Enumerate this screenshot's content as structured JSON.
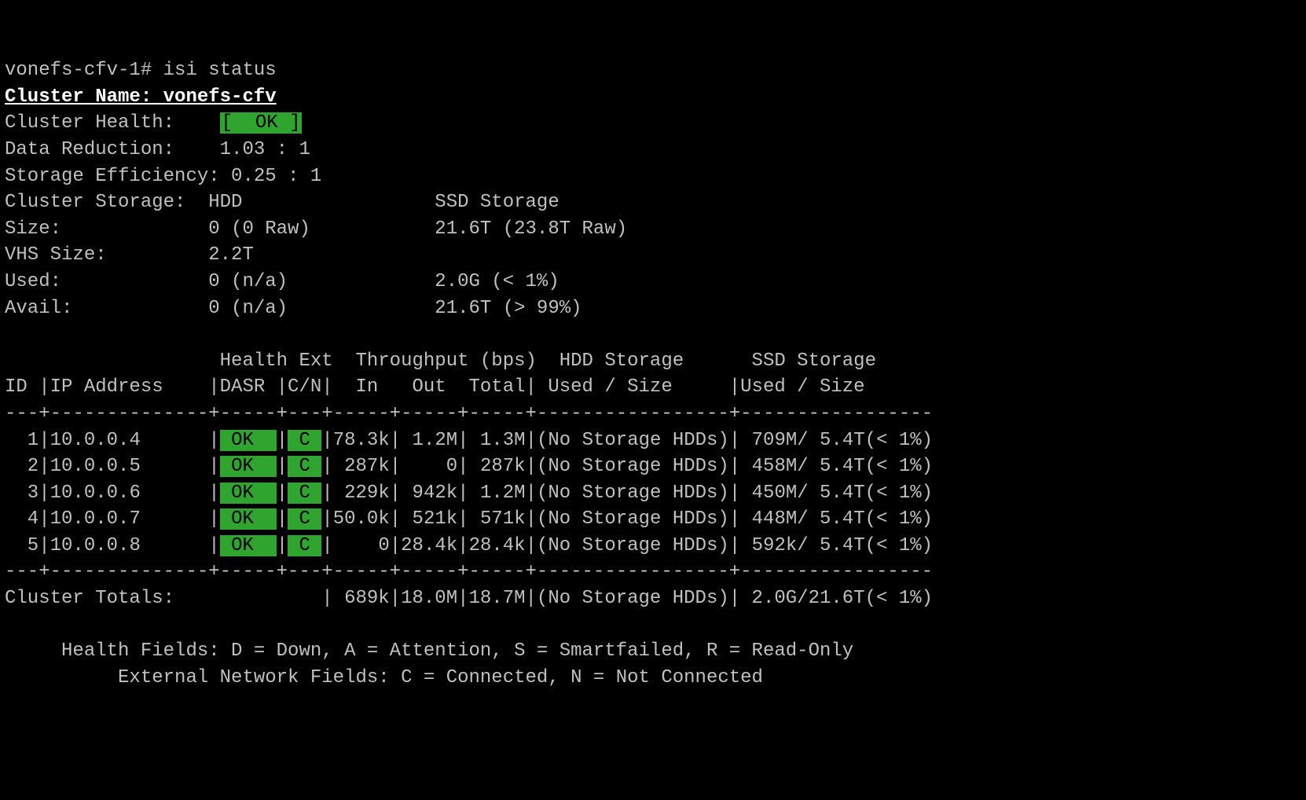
{
  "prompt": "vonefs-cfv-1# ",
  "command": "isi status",
  "clusterNameLabel": "Cluster Name:",
  "clusterName": "vonefs-cfv",
  "healthLabel": "Cluster Health:    ",
  "healthOk": "[  OK ]",
  "dataReductionLabel": "Data Reduction:    ",
  "dataReduction": "1.03 : 1",
  "storageEffLabel": "Storage Efficiency: ",
  "storageEff": "0.25 : 1",
  "hdrStorage": "Cluster Storage:  HDD                 SSD Storage",
  "hdrSize": "Size:             0 (0 Raw)           21.6T (23.8T Raw)",
  "hdrVhs": "VHS Size:         2.2T",
  "hdrUsed": "Used:             0 (n/a)             2.0G (< 1%)",
  "hdrAvail": "Avail:            0 (n/a)             21.6T (> 99%)",
  "tblHdr1": "                   Health Ext  Throughput (bps)  HDD Storage      SSD Storage",
  "tblHdr2": "ID |IP Address    |DASR |C/N|  In   Out  Total| Used / Size     |Used / Size",
  "tblSep": "---+--------------+-----+---+-----+-----+-----+-----------------+-----------------",
  "nodes": [
    {
      "id": "  1",
      "ip": "10.0.0.4      ",
      "ok": " OK  ",
      "c": " C ",
      "in": "78.3k",
      " out": " 1.2M",
      "tot": " 1.3M",
      "hdd": "(No Storage HDDs)",
      "ssd": " 709M/ 5.4T(< 1%)"
    },
    {
      "id": "  2",
      "ip": "10.0.0.5      ",
      "ok": " OK  ",
      "c": " C ",
      "in": " 287k",
      " out": "    0",
      "tot": " 287k",
      "hdd": "(No Storage HDDs)",
      "ssd": " 458M/ 5.4T(< 1%)"
    },
    {
      "id": "  3",
      "ip": "10.0.0.6      ",
      "ok": " OK  ",
      "c": " C ",
      "in": " 229k",
      " out": " 942k",
      "tot": " 1.2M",
      "hdd": "(No Storage HDDs)",
      "ssd": " 450M/ 5.4T(< 1%)"
    },
    {
      "id": "  4",
      "ip": "10.0.0.7      ",
      "ok": " OK  ",
      "c": " C ",
      "in": "50.0k",
      " out": " 521k",
      "tot": " 571k",
      "hdd": "(No Storage HDDs)",
      "ssd": " 448M/ 5.4T(< 1%)"
    },
    {
      "id": "  5",
      "ip": "10.0.0.8      ",
      "ok": " OK  ",
      "c": " C ",
      "in": "    0",
      " out": "28.4k",
      "tot": "28.4k",
      "hdd": "(No Storage HDDs)",
      "ssd": " 592k/ 5.4T(< 1%)"
    }
  ],
  "totalsLabel": "Cluster Totals:             ",
  "totalsRest": "| 689k|18.0M|18.7M|(No Storage HDDs)| 2.0G/21.6T(< 1%)",
  "legend1": "     Health Fields: D = Down, A = Attention, S = Smartfailed, R = Read-Only",
  "legend2": "          External Network Fields: C = Connected, N = Not Connected"
}
